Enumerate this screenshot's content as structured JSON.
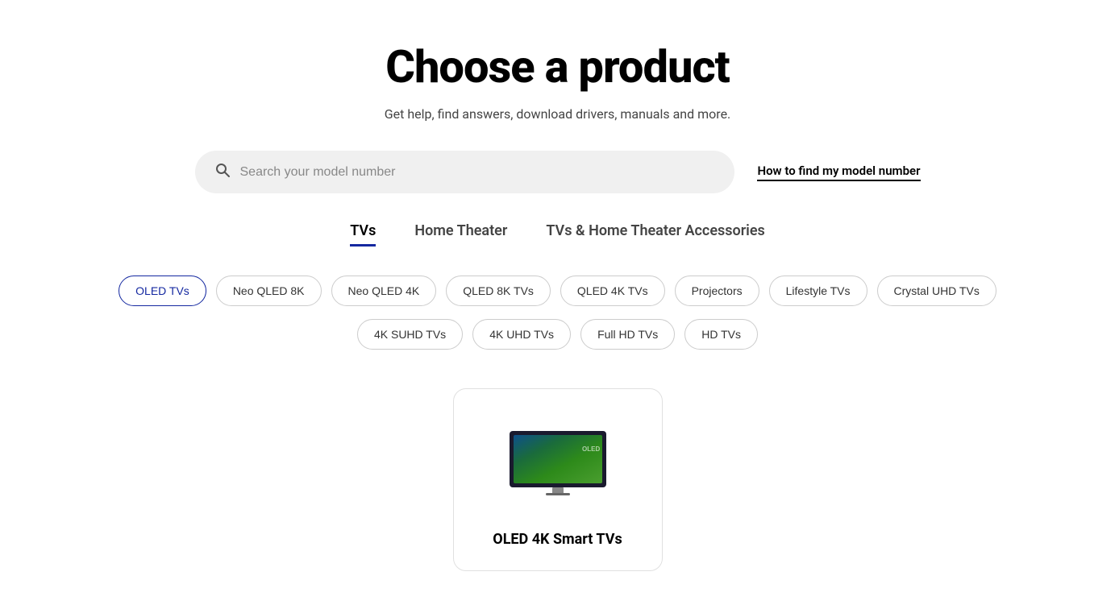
{
  "header": {
    "title": "Choose a product",
    "subtitle": "Get help, find answers, download drivers, manuals and more."
  },
  "search": {
    "placeholder": "Search your model number",
    "model_help_text": "How to find my model number"
  },
  "tabs": [
    {
      "label": "TVs",
      "active": true
    },
    {
      "label": "Home Theater",
      "active": false
    },
    {
      "label": "TVs & Home Theater Accessories",
      "active": false
    }
  ],
  "filter_row_1": [
    {
      "label": "OLED TVs",
      "selected": true
    },
    {
      "label": "Neo QLED 8K",
      "selected": false
    },
    {
      "label": "Neo QLED 4K",
      "selected": false
    },
    {
      "label": "QLED 8K TVs",
      "selected": false
    },
    {
      "label": "QLED 4K TVs",
      "selected": false
    },
    {
      "label": "Projectors",
      "selected": false
    },
    {
      "label": "Lifestyle TVs",
      "selected": false
    },
    {
      "label": "Crystal UHD TVs",
      "selected": false
    }
  ],
  "filter_row_2": [
    {
      "label": "4K SUHD TVs",
      "selected": false
    },
    {
      "label": "4K UHD TVs",
      "selected": false
    },
    {
      "label": "Full HD TVs",
      "selected": false
    },
    {
      "label": "HD TVs",
      "selected": false
    }
  ],
  "product_card": {
    "label": "OLED 4K Smart TVs"
  },
  "colors": {
    "accent": "#1428A0"
  }
}
